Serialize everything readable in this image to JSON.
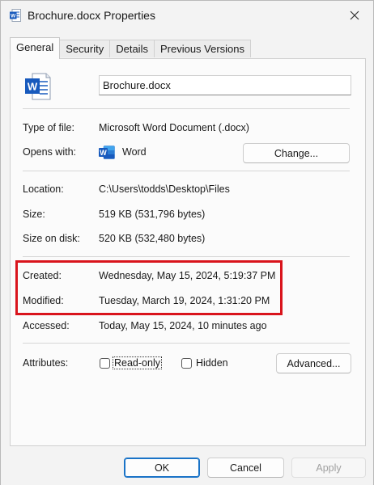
{
  "window": {
    "title": "Brochure.docx Properties",
    "close_icon": "close-icon"
  },
  "tabs": [
    {
      "label": "General",
      "active": true
    },
    {
      "label": "Security",
      "active": false
    },
    {
      "label": "Details",
      "active": false
    },
    {
      "label": "Previous Versions",
      "active": false
    }
  ],
  "file": {
    "name": "Brochure.docx",
    "icon": "word-document-icon"
  },
  "info": {
    "type_label": "Type of file:",
    "type_value": "Microsoft Word Document (.docx)",
    "opens_label": "Opens with:",
    "opens_value": "Word",
    "change_button": "Change...",
    "location_label": "Location:",
    "location_value": "C:\\Users\\todds\\Desktop\\Files",
    "size_label": "Size:",
    "size_value": "519 KB (531,796 bytes)",
    "size_on_disk_label": "Size on disk:",
    "size_on_disk_value": "520 KB (532,480 bytes)",
    "created_label": "Created:",
    "created_value": "Wednesday, May 15, 2024, 5:19:37 PM",
    "modified_label": "Modified:",
    "modified_value": "Tuesday, March 19, 2024, 1:31:20 PM",
    "accessed_label": "Accessed:",
    "accessed_value": "Today, May 15, 2024, 10 minutes ago"
  },
  "attributes": {
    "label": "Attributes:",
    "readonly_label": "Read-only",
    "readonly_checked": false,
    "hidden_label": "Hidden",
    "hidden_checked": false,
    "advanced_button": "Advanced..."
  },
  "footer": {
    "ok": "OK",
    "cancel": "Cancel",
    "apply": "Apply"
  },
  "colors": {
    "highlight": "#d9141c",
    "word_blue": "#185abd",
    "primary_border": "#1a73c7"
  }
}
